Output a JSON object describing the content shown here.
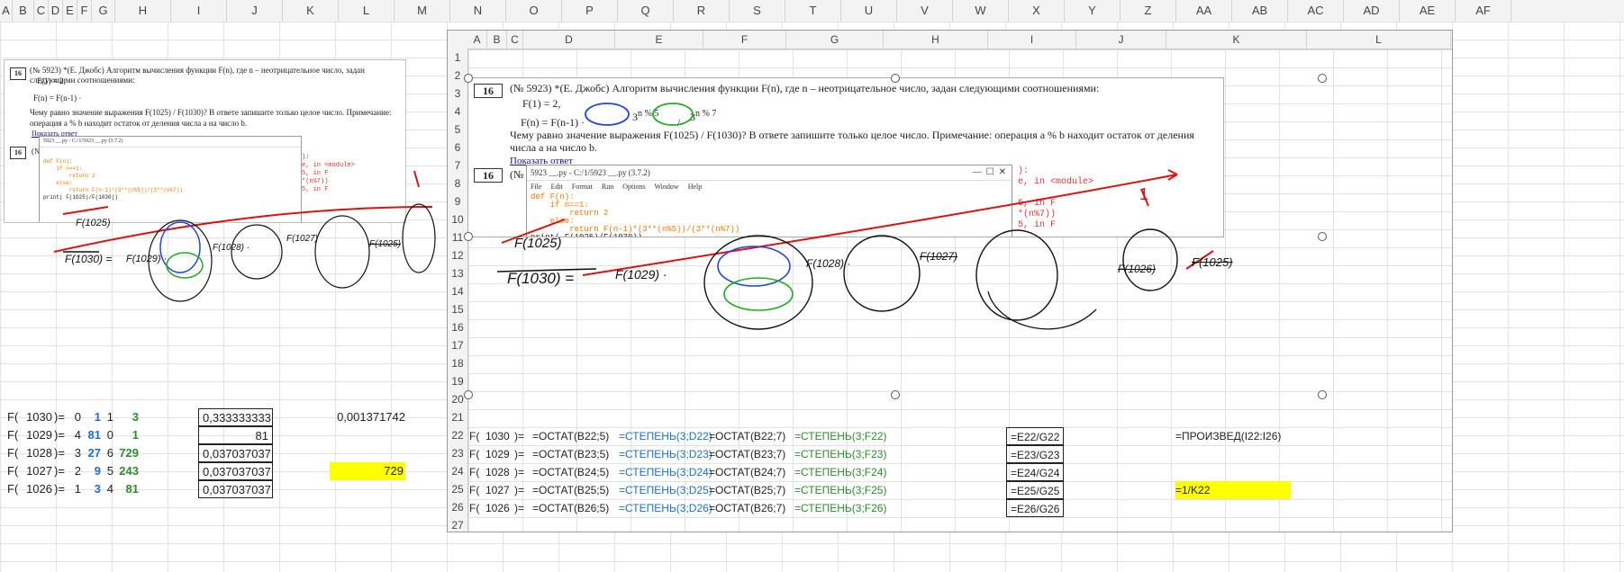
{
  "outer": {
    "columns": [
      "A",
      "B",
      "C",
      "D",
      "E",
      "F",
      "G",
      "H",
      "I",
      "J",
      "K",
      "L",
      "M",
      "N",
      "O",
      "P",
      "Q",
      "R",
      "S",
      "T",
      "U",
      "V",
      "W",
      "X",
      "Y",
      "Z",
      "AA",
      "AB",
      "AC",
      "AD",
      "AE",
      "AF"
    ]
  },
  "problem": {
    "number": "16",
    "header": "(№ 5923) *(Е. Джобс) Алгоритм вычисления функции F(n), где n – неотрицательное число, задан следующими соотношениями:",
    "line1": "F(1)  =  2,",
    "line2": "F(n)  =  F(n-1) ·",
    "frac_num": "3",
    "frac_num_exp": "n % 5",
    "frac_den": "3",
    "frac_den_exp": "n % 7",
    "question": "Чему равно значение выражения F(1025) / F(1030)? В ответе запишите только целое число. Примечание: операция a % b находит остаток от деления числа a на число b.",
    "link": "Показать ответ",
    "number2": "16",
    "number2_suffix": "(№"
  },
  "idle_window": {
    "title": "5923 __.py - C:/1/5923 __.py (3.7.2)",
    "menu": [
      "File",
      "Edit",
      "Format",
      "Run",
      "Options",
      "Window",
      "Help"
    ],
    "code": [
      "def F(n):",
      "    if n==1:",
      "        return 2",
      "    else:",
      "        return F(n-1)*(3**(n%5))/(3**(n%7))",
      "print( F(1025)/F(1030))"
    ],
    "traceback": [
      "):",
      "e, in <module>",
      "",
      "5, in F",
      "*(n%7))",
      "5, in F",
      "*(n%7))"
    ]
  },
  "annotations": {
    "crossed": "F(1025)",
    "lhs": "F(1030) =",
    "t1": "F(1029) ·",
    "t2": "F(1028) ·",
    "t3": "F(1027)",
    "t4": "F(1026)",
    "t5": "F(1025)",
    "arrow_label": "1"
  },
  "outer_table": {
    "rows": [
      {
        "f": "F(",
        "n": "1030",
        "close": ")=",
        "mod5": "0",
        "p5": "1",
        "mod7": "1",
        "p7": "3",
        "ratio": "0,333333333"
      },
      {
        "f": "F(",
        "n": "1029",
        "close": ")=",
        "mod5": "4",
        "p5": "81",
        "mod7": "0",
        "p7": "1",
        "ratio": "81"
      },
      {
        "f": "F(",
        "n": "1028",
        "close": ")=",
        "mod5": "3",
        "p5": "27",
        "mod7": "6",
        "p7": "729",
        "ratio": "0,037037037"
      },
      {
        "f": "F(",
        "n": "1027",
        "close": ")=",
        "mod5": "2",
        "p5": "9",
        "mod7": "5",
        "p7": "243",
        "ratio": "0,037037037"
      },
      {
        "f": "F(",
        "n": "1026",
        "close": ")=",
        "mod5": "1",
        "p5": "3",
        "mod7": "4",
        "p7": "81",
        "ratio": "0,037037037"
      }
    ],
    "product": "0,001371742",
    "answer": "729"
  },
  "inner": {
    "columns": [
      "A",
      "B",
      "C",
      "D",
      "E",
      "F",
      "G",
      "H",
      "I",
      "J",
      "K",
      "L"
    ],
    "rows": [
      "1",
      "2",
      "3",
      "4",
      "5",
      "6",
      "7",
      "8",
      "9",
      "10",
      "11",
      "12",
      "13",
      "14",
      "15",
      "16",
      "17",
      "18",
      "19",
      "20",
      "21",
      "22",
      "23",
      "24",
      "25",
      "26",
      "27"
    ],
    "formulas": [
      {
        "f": "F(",
        "n": "1030",
        "close": ")=",
        "mod5": "=ОСТАТ(B22;5)",
        "p5": "=СТЕПЕНЬ(3;D22)",
        "mod7": "=ОСТАТ(B22;7)",
        "p7": "=СТЕПЕНЬ(3;F22)",
        "ratio": "=E22/G22"
      },
      {
        "f": "F(",
        "n": "1029",
        "close": ")=",
        "mod5": "=ОСТАТ(B23;5)",
        "p5": "=СТЕПЕНЬ(3;D23)",
        "mod7": "=ОСТАТ(B23;7)",
        "p7": "=СТЕПЕНЬ(3;F23)",
        "ratio": "=E23/G23"
      },
      {
        "f": "F(",
        "n": "1028",
        "close": ")=",
        "mod5": "=ОСТАТ(B24;5)",
        "p5": "=СТЕПЕНЬ(3;D24)",
        "mod7": "=ОСТАТ(B24;7)",
        "p7": "=СТЕПЕНЬ(3;F24)",
        "ratio": "=E24/G24"
      },
      {
        "f": "F(",
        "n": "1027",
        "close": ")=",
        "mod5": "=ОСТАТ(B25;5)",
        "p5": "=СТЕПЕНЬ(3;D25)",
        "mod7": "=ОСТАТ(B25;7)",
        "p7": "=СТЕПЕНЬ(3;F25)",
        "ratio": "=E25/G25"
      },
      {
        "f": "F(",
        "n": "1026",
        "close": ")=",
        "mod5": "=ОСТАТ(B26;5)",
        "p5": "=СТЕПЕНЬ(3;D26)",
        "mod7": "=ОСТАТ(B26;7)",
        "p7": "=СТЕПЕНЬ(3;F26)",
        "ratio": "=E26/G26"
      }
    ],
    "product_formula": "=ПРОИЗВЕД(I22:I26)",
    "answer_formula": "=1/K22"
  },
  "colors": {
    "blue": "#1f6fc5",
    "green": "#2e8b2e",
    "highlight": "#ffff00",
    "ink_red": "#e01010"
  }
}
